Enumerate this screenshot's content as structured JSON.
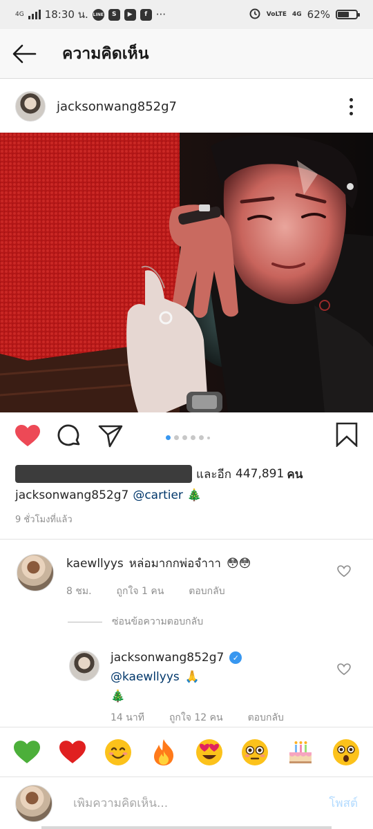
{
  "status_bar": {
    "network": "4G",
    "time": "18:30 น.",
    "apps": [
      "LINE",
      "S",
      "▶",
      "f"
    ],
    "more": "···",
    "volte": "VoLTE",
    "net_right": "4G",
    "battery": "62%"
  },
  "header": {
    "title": "ความคิดเห็น"
  },
  "post": {
    "username": "jacksonwang852g7",
    "likes_text": "และอีก",
    "likes_count": "447,891",
    "likes_unit": "คน",
    "caption_user": "jacksonwang852g7",
    "caption_mention": "@cartier",
    "caption_emoji": "🎄",
    "time_ago": "9 ชั่วโมงที่แล้ว",
    "carousel_index": 1,
    "carousel_total": 6
  },
  "comments": [
    {
      "username": "kaewllyys",
      "text": "หล่อมากกพ่อจำาา",
      "emoji": "😳😳",
      "time": "8 ชม.",
      "likes": "ถูกใจ 1 คน",
      "reply": "ตอบกลับ"
    }
  ],
  "hide_replies": "ซ่อนข้อความตอบกลับ",
  "reply": {
    "username": "jacksonwang852g7",
    "mention": "@kaewllyys",
    "emoji1": "🙏",
    "emoji2": "🎄",
    "time": "14 นาที",
    "likes": "ถูกใจ 12 คน",
    "reply": "ตอบกลับ"
  },
  "emoji_bar": [
    "💚",
    "❤️",
    "😊",
    "🔥",
    "😍",
    "😳",
    "🎂",
    "😮"
  ],
  "composer": {
    "placeholder": "เพิ่มความคิดเห็น...",
    "post_label": "โพสต์"
  },
  "colors": {
    "like_red": "#ed4956",
    "link_blue": "#00376b",
    "accent_blue": "#3897f0",
    "post_disabled": "#b3dbff"
  }
}
